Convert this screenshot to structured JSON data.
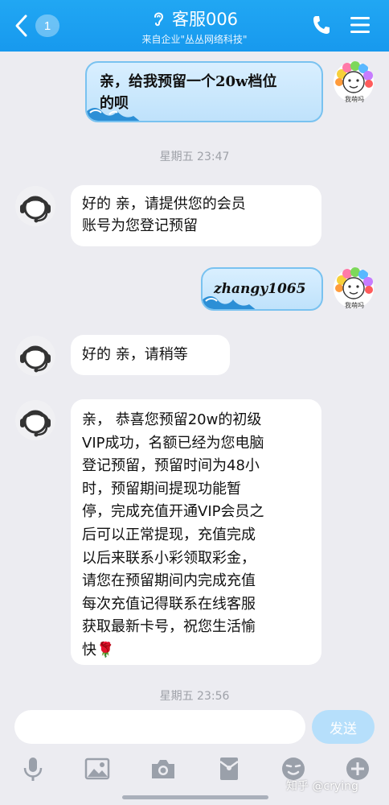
{
  "header": {
    "back_badge": "1",
    "title": "客服006",
    "subtitle": "来自企业\"丛丛网络科技\"",
    "icons": [
      "ear-icon",
      "phone-icon",
      "menu-icon"
    ],
    "color": "#1da3f2"
  },
  "messages": [
    {
      "side": "right",
      "text_lines": [
        "亲，给我预留一个20w档位",
        "的呗"
      ],
      "avatar_caption": "我萌吗"
    },
    {
      "side": "left",
      "text_lines": [
        "好的  亲，请提供您的会员",
        "账号为您登记预留"
      ]
    },
    {
      "side": "right",
      "text_lines": [
        "zhangy1065"
      ],
      "avatar_caption": "我萌吗"
    },
    {
      "side": "left",
      "text_lines": [
        "好的 亲，请稍等"
      ]
    },
    {
      "side": "left",
      "text_lines": [
        "亲，  恭喜您预留20w的初级",
        "VIP成功，名额已经为您电脑",
        "登记预留，预留时间为48小",
        "时，预留期间提现功能暂",
        "停，完成充值开通VIP会员之",
        "后可以正常提现，充值完成",
        "以后来联系小彩领取彩金，",
        "请您在预留期间内完成充值",
        "每次充值记得联系在线客服",
        "获取最新卡号，祝您生活愉",
        "快🌹"
      ]
    }
  ],
  "timestamps": [
    "星期五 23:47",
    "星期五 23:56"
  ],
  "input": {
    "placeholder": "",
    "send_label": "发送"
  },
  "toolbar": [
    "microphone-icon",
    "image-icon",
    "camera-icon",
    "red-packet-icon",
    "emoji-icon",
    "plus-icon"
  ],
  "watermark": "知乎 @crying"
}
